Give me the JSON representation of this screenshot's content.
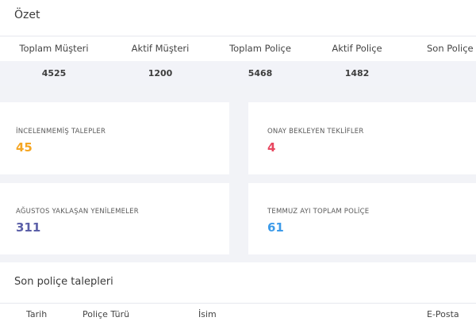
{
  "summary": {
    "title": "Özet",
    "headers": [
      "Toplam Müşteri",
      "Aktif Müşteri",
      "Toplam Poliçe",
      "Aktif Poliçe",
      "Son Poliçe T"
    ],
    "values": [
      "4525",
      "1200",
      "5468",
      "1482",
      ""
    ]
  },
  "stats": [
    {
      "label": "İNCELENMEMİŞ TALEPLER",
      "value": "45",
      "color": "#f5a623"
    },
    {
      "label": "ONAY BEKLEYEN TEKLİFLER",
      "value": "4",
      "color": "#e8475f"
    },
    {
      "label": "AĞUSTOS YAKLAŞAN YENİLEMELER",
      "value": "311",
      "color": "#5b5fa8"
    },
    {
      "label": "TEMMUZ AYI TOPLAM POLİÇE",
      "value": "61",
      "color": "#3d9be9"
    }
  ],
  "requests": {
    "title": "Son poliçe talepleri",
    "columns": [
      "Tarih",
      "Poliçe Türü",
      "İsim",
      "E-Posta"
    ]
  }
}
